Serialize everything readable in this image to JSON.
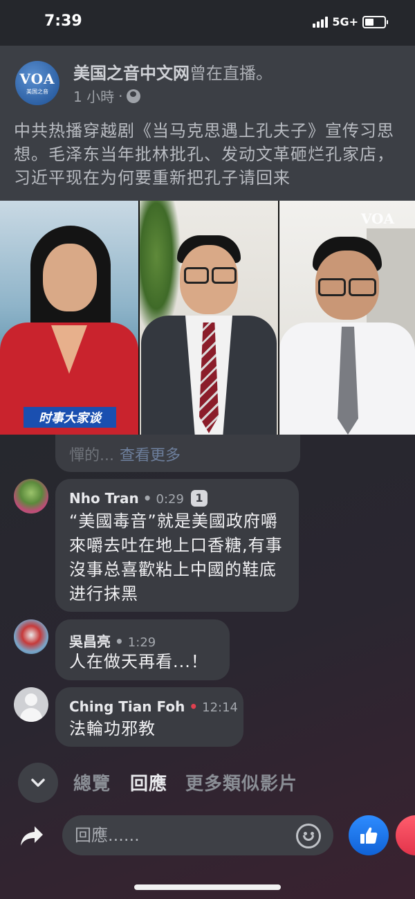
{
  "status_bar": {
    "time": "7:39",
    "network": "5G+"
  },
  "post": {
    "avatar_text": "VOA",
    "avatar_subtext": "美国之音",
    "page_name": "美国之音中文网",
    "live_status": "曾在直播。",
    "timestamp": "1 小時",
    "meta_sep": "·",
    "text": "中共热播穿越剧《当马克思遇上孔夫子》宣传习思想。毛泽东当年批林批孔、发动文革砸烂孔家店，习近平现在为何要重新把孔子请回来"
  },
  "video": {
    "caption": "时事大家谈",
    "watermark": "VOA"
  },
  "previous_comment": {
    "text": "憚的...",
    "see_more": "查看更多"
  },
  "comments": [
    {
      "name": "Nho Tran",
      "dot": "•",
      "time": "0:29",
      "badge": "1",
      "text": "“美國毒音”就是美國政府嚼來嚼去吐在地上口香糖,有事沒事总喜歡粘上中國的鞋底进行抹黑"
    },
    {
      "name": "吳昌亮",
      "dot": "•",
      "time": "1:29",
      "text": "人在做天再看...！"
    },
    {
      "name": "Ching Tian Foh",
      "dot": "•",
      "time": "12:14",
      "text": "法輪功邪教"
    }
  ],
  "tabs": {
    "overview": "總覽",
    "replies": "回應",
    "more_videos": "更多類似影片"
  },
  "reply_bar": {
    "placeholder": "回應......"
  },
  "icons": [
    "chevron-down-icon",
    "share-icon",
    "emoji-icon",
    "thumbs-up-icon",
    "heart-icon",
    "globe-icon"
  ],
  "colors": {
    "like_blue": "#1877f2",
    "love_red": "#f0405a",
    "live_dot": "#e0404f"
  }
}
